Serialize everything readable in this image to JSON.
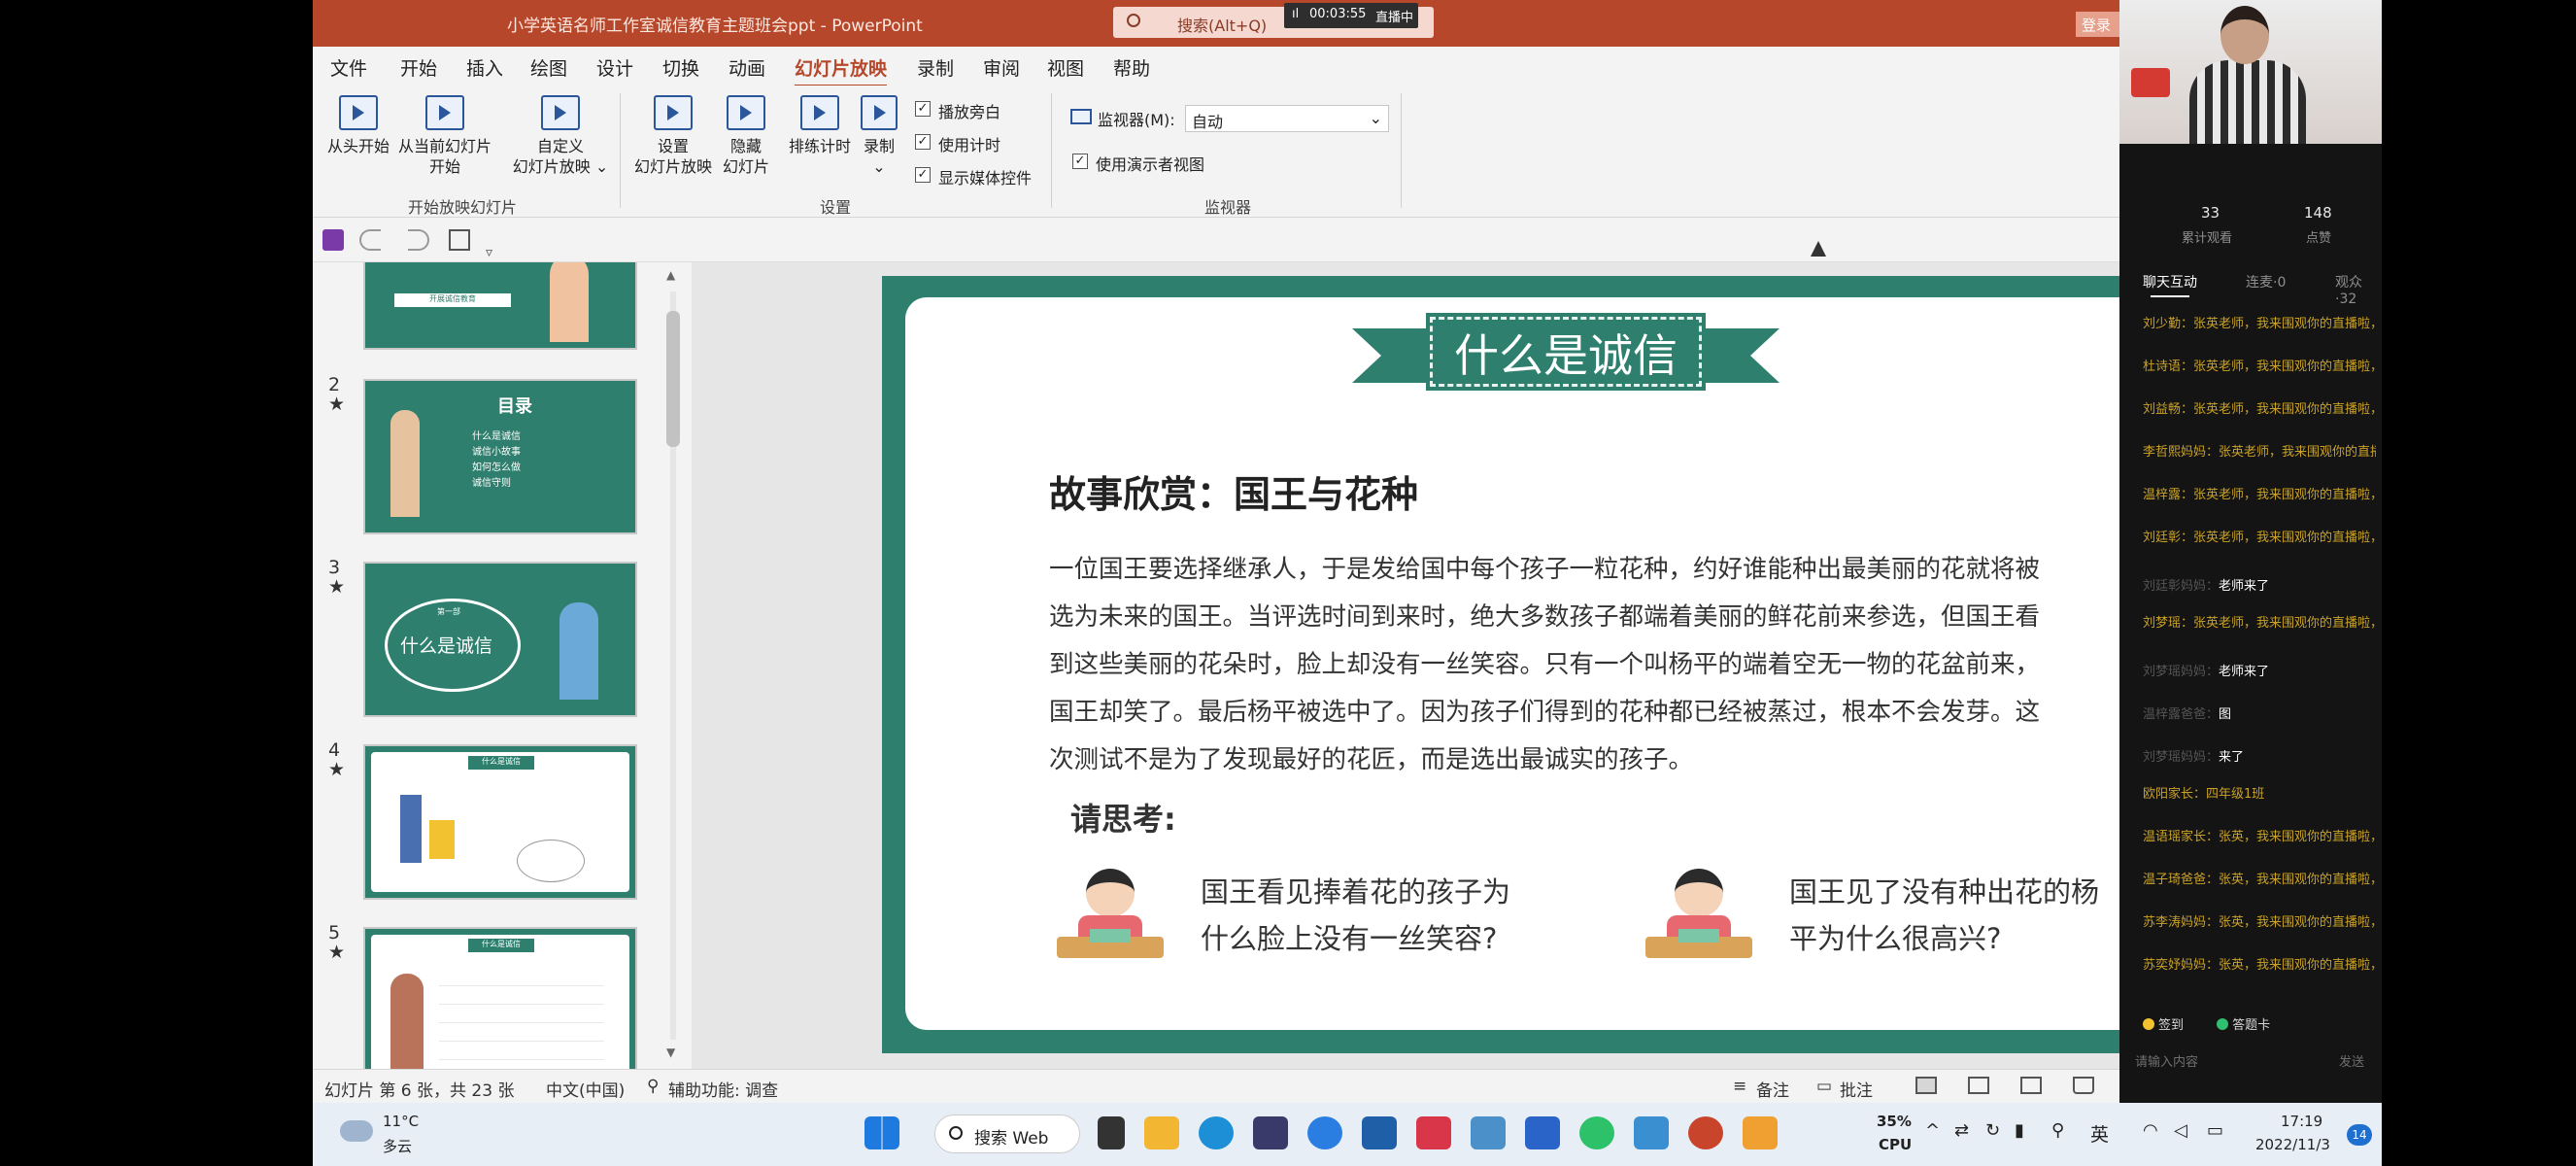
{
  "window": {
    "title": "小学英语名师工作室诚信教育主题班会ppt  -  PowerPoint",
    "search_placeholder": "搜索(Alt+Q)",
    "live_timer": "00:03:55",
    "live_status": "直播中",
    "login_label": "登录"
  },
  "menu": [
    "文件",
    "开始",
    "插入",
    "绘图",
    "设计",
    "切换",
    "动画",
    "幻灯片放映",
    "录制",
    "审阅",
    "视图",
    "帮助"
  ],
  "menu_active": "幻灯片放映",
  "ribbon": {
    "start_group": {
      "from_beginning": "从头开始",
      "from_current_1": "从当前幻灯片",
      "from_current_2": "开始",
      "custom_1": "自定义",
      "custom_2": "幻灯片放映 ⌄",
      "label": "开始放映幻灯片"
    },
    "setup_group": {
      "setup_1": "设置",
      "setup_2": "幻灯片放映",
      "hide_1": "隐藏",
      "hide_2": "幻灯片",
      "rehearse": "排练计时",
      "record": "录制",
      "record_arrow": "⌄",
      "play_narration": "播放旁白",
      "use_timings": "使用计时",
      "show_media": "显示媒体控件",
      "label": "设置"
    },
    "monitor_group": {
      "monitor_label": "监视器(M):",
      "monitor_value": "自动",
      "presenter_view": "使用演示者视图",
      "label": "监视器"
    }
  },
  "thumbnails": [
    {
      "num": "",
      "title": "开展诚信教育"
    },
    {
      "num": "2",
      "star": "★",
      "title": "目录",
      "items": [
        "什么是诚信",
        "诚信小故事",
        "如何怎么做",
        "诚信守则"
      ]
    },
    {
      "num": "3",
      "star": "★",
      "title": "什么是诚信",
      "sub": "第一部"
    },
    {
      "num": "4",
      "star": "★",
      "title": "什么是诚信"
    },
    {
      "num": "5",
      "star": "★",
      "title": "什么是诚信"
    }
  ],
  "slide": {
    "banner": "什么是诚信",
    "story_title": "故事欣赏：国王与花种",
    "story_lines": [
      "一位国王要选择继承人，于是发给国中每个孩子一粒花种，约好谁能种出最美丽的花就将被",
      "选为未来的国王。当评选时间到来时，绝大多数孩子都端着美丽的鲜花前来参选，但国王看",
      "到这些美丽的花朵时，脸上却没有一丝笑容。只有一个叫杨平的端着空无一物的花盆前来，",
      "国王却笑了。最后杨平被选中了。因为孩子们得到的花种都已经被蒸过，根本不会发芽。这",
      "次测试不是为了发现最好的花匠，而是选出最诚实的孩子。"
    ],
    "think_label": "请思考:",
    "q1_line1": "国王看见捧着花的孩子为",
    "q1_line2": "什么脸上没有一丝笑容?",
    "q2_line1": "国王见了没有种出花的杨",
    "q2_line2": "平为什么很高兴?"
  },
  "status": {
    "slide_info": "幻灯片 第 6 张，共 23 张",
    "language": "中文(中国)",
    "accessibility": "辅助功能: 调查",
    "notes": "备注",
    "comments": "批注"
  },
  "taskbar": {
    "weather_temp": "11°C",
    "weather_desc": "多云",
    "search": "搜索 Web",
    "cpu_pct": "35%",
    "cpu_label": "CPU",
    "ime": "英",
    "time": "17:19",
    "date": "2022/11/3",
    "badge": "14"
  },
  "live": {
    "stat1_num": "33",
    "stat1_label": "累计观看",
    "stat2_num": "148",
    "stat2_label": "点赞",
    "tabs": [
      "聊天互动",
      "连麦·0",
      "观众·32"
    ],
    "chat": [
      {
        "who": "刘少勤：",
        "text": "张英老师，我来围观你的直播啦，为你点赞!",
        "hl": true
      },
      {
        "who": "杜诗语：",
        "text": "张英老师，我来围观你的直播啦，为你点赞!",
        "hl": true
      },
      {
        "who": "刘益畅：",
        "text": "张英老师，我来围观你的直播啦，为你点赞!",
        "hl": true
      },
      {
        "who": "李哲熙妈妈：",
        "text": "张英老师，我来围观你的直播啦，为你点赞!",
        "hl": true
      },
      {
        "who": "温梓露：",
        "text": "张英老师，我来围观你的直播啦，为你点赞!",
        "hl": true
      },
      {
        "who": "刘廷彰：",
        "text": "张英老师，我来围观你的直播啦，为你点赞!",
        "hl": true
      },
      {
        "who": "刘廷彰妈妈：",
        "text": "老师来了",
        "hl": false
      },
      {
        "who": "刘梦瑶：",
        "text": "张英老师，我来围观你的直播啦，为你点赞!",
        "hl": true
      },
      {
        "who": "刘梦瑶妈妈：",
        "text": "老师来了",
        "hl": false
      },
      {
        "who": "温梓露爸爸：",
        "text": "图",
        "hl": false
      },
      {
        "who": "刘梦瑶妈妈：",
        "text": "来了",
        "hl": false
      },
      {
        "who": "欧阳家长：",
        "text": "四年级1班",
        "hl": true
      },
      {
        "who": "温语瑶家长：",
        "text": "张英，我来围观你的直播啦，为你点赞!",
        "hl": true
      },
      {
        "who": "温子琦爸爸：",
        "text": "张英，我来围观你的直播啦，为你点赞!",
        "hl": true
      },
      {
        "who": "苏李涛妈妈：",
        "text": "张英，我来围观你的直播啦，为你点赞!",
        "hl": true
      },
      {
        "who": "苏奕妤妈妈：",
        "text": "张英，我来围观你的直播啦，为你点赞!",
        "hl": true
      }
    ],
    "gift1": "签到",
    "gift2": "答题卡",
    "input_placeholder": "请输入内容",
    "send": "发送"
  },
  "colors": {
    "ppt_accent": "#b7472a",
    "slide_green": "#2e7f6e",
    "chat_gold": "#c9a227"
  }
}
